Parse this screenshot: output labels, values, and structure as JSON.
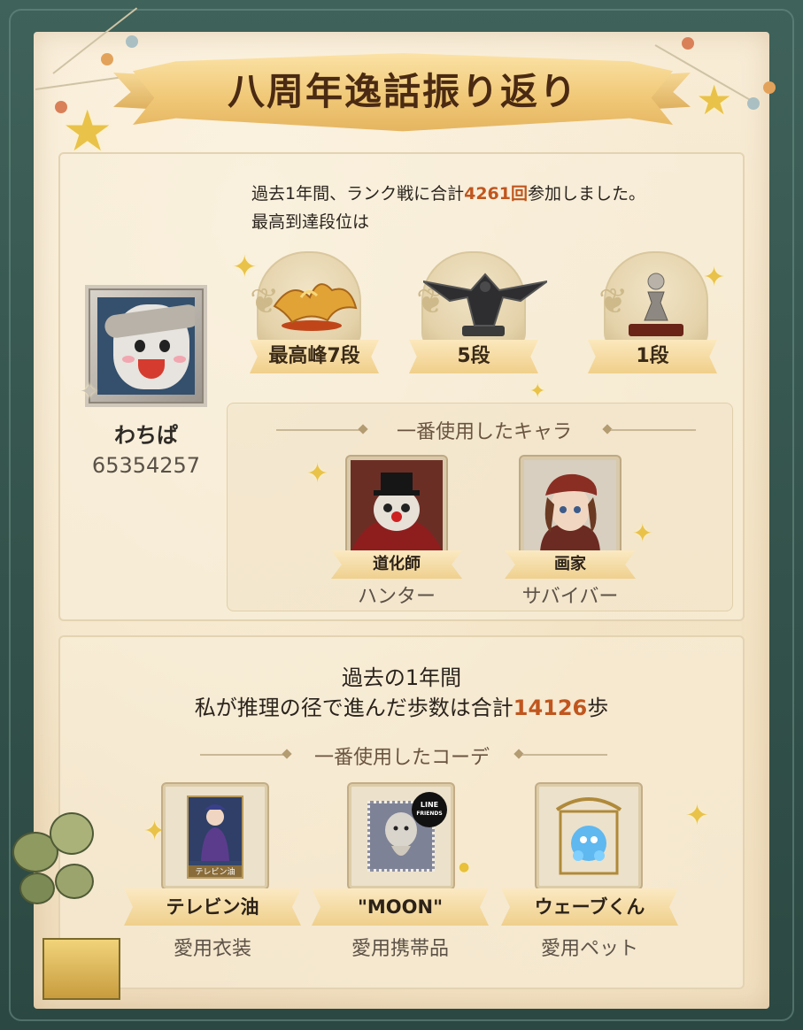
{
  "title": "八周年逸話振り返り",
  "player": {
    "name": "わちぱ",
    "id": "65354257"
  },
  "rank_summary": {
    "line1_prefix": "過去1年間、ランク戦に合計",
    "line1_count": "4261回",
    "line1_suffix": "参加しました。",
    "line2": "最高到達段位は",
    "ranks": [
      {
        "label": "最高峰7段",
        "icon": "gold-dragon-trophy-icon"
      },
      {
        "label": "5段",
        "icon": "black-dragon-trophy-icon"
      },
      {
        "label": "1段",
        "icon": "pawn-trophy-icon"
      }
    ]
  },
  "characters": {
    "heading": "一番使用したキャラ",
    "items": [
      {
        "name": "道化師",
        "role": "ハンター",
        "icon": "clown-portrait-icon"
      },
      {
        "name": "画家",
        "role": "サバイバー",
        "icon": "painter-portrait-icon"
      }
    ]
  },
  "steps": {
    "line1": "過去の1年間",
    "line2_prefix": "私が推理の径で進んだ歩数は合計",
    "line2_count": "14126",
    "line2_suffix": "歩"
  },
  "outfits": {
    "heading": "一番使用したコーデ",
    "items": [
      {
        "name": "テレビン油",
        "category": "愛用衣装",
        "icon": "costume-card-icon",
        "card_caption": "テレビン油"
      },
      {
        "name": "\"MOON\"",
        "category": "愛用携帯品",
        "icon": "moon-stamp-icon",
        "badge_line1": "LINE",
        "badge_line2": "FRIENDS"
      },
      {
        "name": "ウェーブくん",
        "category": "愛用ペット",
        "icon": "blue-pet-cage-icon"
      }
    ]
  },
  "colors": {
    "frame": "#34544d",
    "paper": "#f6e8cf",
    "highlight": "#c0561e",
    "ribbon": "#f0cf8a"
  }
}
